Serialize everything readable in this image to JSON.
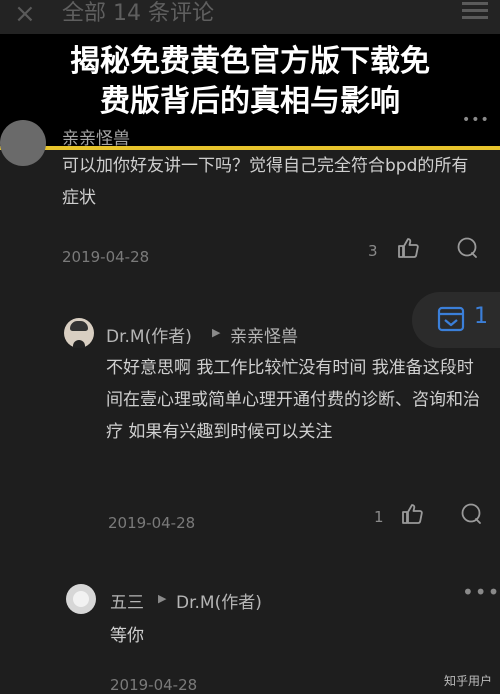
{
  "header": {
    "close": "×",
    "title": "全部 14 条评论"
  },
  "banner": {
    "line1": "揭秘免费黄色官方版下载免",
    "line2": "费版背后的真相与影响"
  },
  "ghost": {
    "left": "评论",
    "right": "赞"
  },
  "comments": [
    {
      "name": "亲亲怪兽",
      "text": "可以加你好友讲一下吗？觉得自己完全符合bpd的所有症状",
      "date": "2019-04-28",
      "likes": "3"
    },
    {
      "name": "Dr.M(作者)",
      "reply_to": "亲亲怪兽",
      "text": "不好意思啊 我工作比较忙没有时间 我准备这段时间在壹心理或简单心理开通付费的诊断、咨询和治疗 如果有兴趣到时候可以关注",
      "date": "2019-04-28",
      "likes": "1"
    },
    {
      "name": "五三",
      "reply_to": "Dr.M(作者)",
      "text": "等你",
      "date": "2019-04-28"
    }
  ],
  "float_button": {
    "count": "1"
  },
  "watermark": "知乎用户",
  "colors": {
    "accent": "#3b7fd9",
    "banner_border": "#e7c42c"
  }
}
